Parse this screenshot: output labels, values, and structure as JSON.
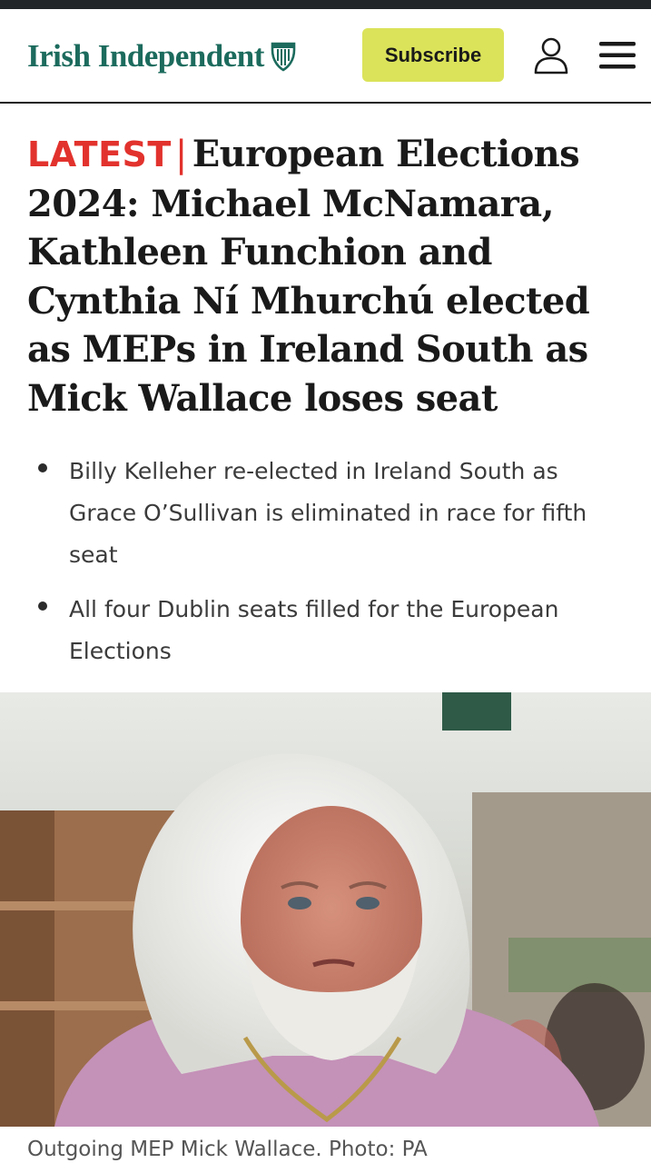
{
  "header": {
    "logo_text": "Irish Independent",
    "logo_icon": "harp-icon",
    "subscribe_label": "Subscribe",
    "account_icon": "user-icon",
    "menu_icon": "hamburger-menu-icon"
  },
  "article": {
    "tag": "LATEST",
    "separator": "|",
    "headline": "European Elections 2024: Michael McNamara, Kathleen Funchion and Cynthia Ní Mhurchú elected as MEPs in Ireland South as Mick Wallace loses seat",
    "bullets": [
      "Billy Kelleher re-elected in Ireland South as Grace O’Sullivan is eliminated in race for fifth seat",
      "All four Dublin seats filled for the European Elections"
    ],
    "photo_caption": "Outgoing MEP Mick Wallace. Photo: PA"
  },
  "colors": {
    "brand": "#1c6b5d",
    "latest_red": "#e2322d",
    "subscribe_bg": "#dbe35a"
  }
}
